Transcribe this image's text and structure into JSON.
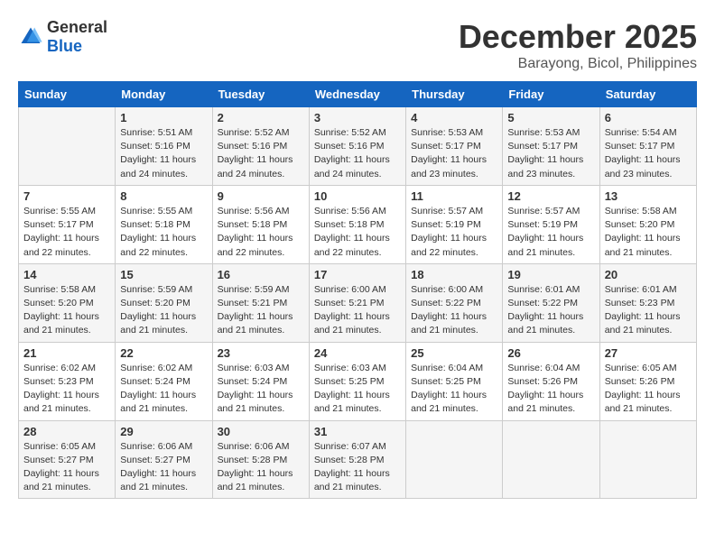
{
  "logo": {
    "general": "General",
    "blue": "Blue"
  },
  "title": "December 2025",
  "location": "Barayong, Bicol, Philippines",
  "days_of_week": [
    "Sunday",
    "Monday",
    "Tuesday",
    "Wednesday",
    "Thursday",
    "Friday",
    "Saturday"
  ],
  "weeks": [
    [
      {
        "day": "",
        "info": ""
      },
      {
        "day": "1",
        "info": "Sunrise: 5:51 AM\nSunset: 5:16 PM\nDaylight: 11 hours\nand 24 minutes."
      },
      {
        "day": "2",
        "info": "Sunrise: 5:52 AM\nSunset: 5:16 PM\nDaylight: 11 hours\nand 24 minutes."
      },
      {
        "day": "3",
        "info": "Sunrise: 5:52 AM\nSunset: 5:16 PM\nDaylight: 11 hours\nand 24 minutes."
      },
      {
        "day": "4",
        "info": "Sunrise: 5:53 AM\nSunset: 5:17 PM\nDaylight: 11 hours\nand 23 minutes."
      },
      {
        "day": "5",
        "info": "Sunrise: 5:53 AM\nSunset: 5:17 PM\nDaylight: 11 hours\nand 23 minutes."
      },
      {
        "day": "6",
        "info": "Sunrise: 5:54 AM\nSunset: 5:17 PM\nDaylight: 11 hours\nand 23 minutes."
      }
    ],
    [
      {
        "day": "7",
        "info": "Sunrise: 5:55 AM\nSunset: 5:17 PM\nDaylight: 11 hours\nand 22 minutes."
      },
      {
        "day": "8",
        "info": "Sunrise: 5:55 AM\nSunset: 5:18 PM\nDaylight: 11 hours\nand 22 minutes."
      },
      {
        "day": "9",
        "info": "Sunrise: 5:56 AM\nSunset: 5:18 PM\nDaylight: 11 hours\nand 22 minutes."
      },
      {
        "day": "10",
        "info": "Sunrise: 5:56 AM\nSunset: 5:18 PM\nDaylight: 11 hours\nand 22 minutes."
      },
      {
        "day": "11",
        "info": "Sunrise: 5:57 AM\nSunset: 5:19 PM\nDaylight: 11 hours\nand 22 minutes."
      },
      {
        "day": "12",
        "info": "Sunrise: 5:57 AM\nSunset: 5:19 PM\nDaylight: 11 hours\nand 21 minutes."
      },
      {
        "day": "13",
        "info": "Sunrise: 5:58 AM\nSunset: 5:20 PM\nDaylight: 11 hours\nand 21 minutes."
      }
    ],
    [
      {
        "day": "14",
        "info": "Sunrise: 5:58 AM\nSunset: 5:20 PM\nDaylight: 11 hours\nand 21 minutes."
      },
      {
        "day": "15",
        "info": "Sunrise: 5:59 AM\nSunset: 5:20 PM\nDaylight: 11 hours\nand 21 minutes."
      },
      {
        "day": "16",
        "info": "Sunrise: 5:59 AM\nSunset: 5:21 PM\nDaylight: 11 hours\nand 21 minutes."
      },
      {
        "day": "17",
        "info": "Sunrise: 6:00 AM\nSunset: 5:21 PM\nDaylight: 11 hours\nand 21 minutes."
      },
      {
        "day": "18",
        "info": "Sunrise: 6:00 AM\nSunset: 5:22 PM\nDaylight: 11 hours\nand 21 minutes."
      },
      {
        "day": "19",
        "info": "Sunrise: 6:01 AM\nSunset: 5:22 PM\nDaylight: 11 hours\nand 21 minutes."
      },
      {
        "day": "20",
        "info": "Sunrise: 6:01 AM\nSunset: 5:23 PM\nDaylight: 11 hours\nand 21 minutes."
      }
    ],
    [
      {
        "day": "21",
        "info": "Sunrise: 6:02 AM\nSunset: 5:23 PM\nDaylight: 11 hours\nand 21 minutes."
      },
      {
        "day": "22",
        "info": "Sunrise: 6:02 AM\nSunset: 5:24 PM\nDaylight: 11 hours\nand 21 minutes."
      },
      {
        "day": "23",
        "info": "Sunrise: 6:03 AM\nSunset: 5:24 PM\nDaylight: 11 hours\nand 21 minutes."
      },
      {
        "day": "24",
        "info": "Sunrise: 6:03 AM\nSunset: 5:25 PM\nDaylight: 11 hours\nand 21 minutes."
      },
      {
        "day": "25",
        "info": "Sunrise: 6:04 AM\nSunset: 5:25 PM\nDaylight: 11 hours\nand 21 minutes."
      },
      {
        "day": "26",
        "info": "Sunrise: 6:04 AM\nSunset: 5:26 PM\nDaylight: 11 hours\nand 21 minutes."
      },
      {
        "day": "27",
        "info": "Sunrise: 6:05 AM\nSunset: 5:26 PM\nDaylight: 11 hours\nand 21 minutes."
      }
    ],
    [
      {
        "day": "28",
        "info": "Sunrise: 6:05 AM\nSunset: 5:27 PM\nDaylight: 11 hours\nand 21 minutes."
      },
      {
        "day": "29",
        "info": "Sunrise: 6:06 AM\nSunset: 5:27 PM\nDaylight: 11 hours\nand 21 minutes."
      },
      {
        "day": "30",
        "info": "Sunrise: 6:06 AM\nSunset: 5:28 PM\nDaylight: 11 hours\nand 21 minutes."
      },
      {
        "day": "31",
        "info": "Sunrise: 6:07 AM\nSunset: 5:28 PM\nDaylight: 11 hours\nand 21 minutes."
      },
      {
        "day": "",
        "info": ""
      },
      {
        "day": "",
        "info": ""
      },
      {
        "day": "",
        "info": ""
      }
    ]
  ]
}
